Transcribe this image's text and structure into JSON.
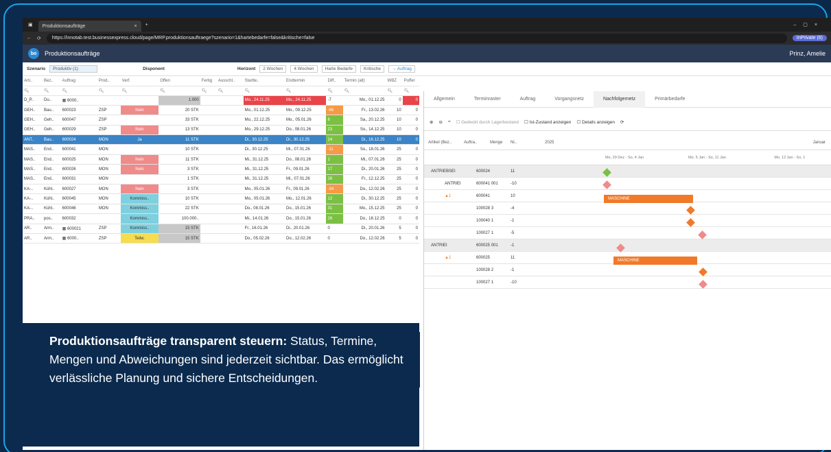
{
  "browser": {
    "tab_title": "Produktionsaufträge",
    "url": "https://innotab.test.businessexpress.cloud/page/MRP.produktionsauftraege?szenario=1&hartebedarfe=false&kritische=false",
    "profile": "InPrivate (6)"
  },
  "app": {
    "title": "Produktionsaufträge",
    "user": "Prinz, Amelie"
  },
  "filters": {
    "szenario_label": "Szenario",
    "szenario_value": "Produktiv (1)",
    "disponent_label": "Disponent",
    "horizont_label": "Horizont",
    "h1": "2 Wochen",
    "h2": "4 Wochen",
    "harte": "Harte Bedarfe",
    "kritische": "Kritische",
    "auftrag": "→ Auftrag"
  },
  "table": {
    "headers": [
      "Arti..",
      "Bez..",
      "Auftrag",
      "Prod..",
      "Verf.",
      "Offen",
      "Fertig",
      "Ausschl..",
      "Startte..",
      "Endtermin",
      "Diff..",
      "Termin (alt)",
      "WBZ",
      "Puffer"
    ],
    "rows": [
      [
        "D_P..",
        "Du..",
        "▦ 6000..",
        "",
        "",
        "1.000",
        "",
        "",
        "Mo., 24.11.25",
        "Mo., 24.11.25",
        "-7",
        "Mo., 01.12.25",
        "0",
        "0"
      ],
      [
        "GEH..",
        "Bau..",
        "600023",
        "ZSP",
        "Nein",
        "20 STK",
        "",
        "",
        "Mo., 01.12.25",
        "Mo., 09.12.25",
        "-66",
        "Fr., 13.02.26",
        "10",
        "0"
      ],
      [
        "GEH..",
        "Geh..",
        "600047",
        "ZSP",
        "",
        "33 STK",
        "",
        "",
        "Mo., 22.12.25",
        "Mo., 05.01.26",
        "6",
        "Sa., 20.12.25",
        "10",
        "0"
      ],
      [
        "GEH..",
        "Geh..",
        "600029",
        "ZSP",
        "Nein",
        "13 STK",
        "",
        "",
        "Mo., 29.12.25",
        "Do., 08.01.26",
        "23",
        "So., 14.12.25",
        "10",
        "0"
      ],
      [
        "ANT..",
        "Bau..",
        "600024",
        "MON",
        "Ja",
        "11 STK",
        "",
        "",
        "Di., 30.12.25",
        "Di., 30.12.25",
        "14",
        "Di., 16.12.25",
        "10",
        "0"
      ],
      [
        "MAS..",
        "End..",
        "600041",
        "MON",
        "",
        "10 STK",
        "",
        "",
        "Di., 30.12.25",
        "Mi., 07.01.26",
        "-11",
        "So., 18.01.26",
        "25",
        "0"
      ],
      [
        "MAS..",
        "End..",
        "600025",
        "MON",
        "Nein",
        "11 STK",
        "",
        "",
        "Mi., 31.12.25",
        "Do., 08.01.26",
        "1",
        "Mi., 07.01.26",
        "25",
        "0"
      ],
      [
        "MAS..",
        "End..",
        "600026",
        "MON",
        "Nein",
        "3 STK",
        "",
        "",
        "Mi., 31.12.25",
        "Fr., 09.01.26",
        "17",
        "Di., 20.01.26",
        "25",
        "0"
      ],
      [
        "MAS..",
        "End..",
        "600031",
        "MON",
        "",
        "1 STK",
        "",
        "",
        "Mi., 31.12.25",
        "Mi., 07.01.26",
        "26",
        "Fr., 12.12.25",
        "25",
        "0"
      ],
      [
        "KA-..",
        "Kühl..",
        "600027",
        "MON",
        "Nein",
        "3 STK",
        "",
        "",
        "Mo., 05.01.26",
        "Fr., 09.01.26",
        "-34",
        "Do., 12.02.26",
        "25",
        "0"
      ],
      [
        "KA-..",
        "Kühl..",
        "600045",
        "MON",
        "Kommiss..",
        "10 STK",
        "",
        "",
        "Mo., 05.01.26",
        "Mo., 12.01.26",
        "12",
        "Di., 30.12.25",
        "25",
        "0"
      ],
      [
        "KA-..",
        "Kühl..",
        "600046",
        "MON",
        "Kommiss..",
        "22 STK",
        "",
        "",
        "Do., 08.01.26",
        "Do., 15.01.26",
        "31",
        "Mo., 15.12.25",
        "25",
        "0"
      ],
      [
        "PRA..",
        "pos..",
        "600032",
        "",
        "Kommiss..",
        "100.000..",
        "",
        "",
        "Mi., 14.01.26",
        "Do., 15.01.26",
        "26",
        "Do., 18.12.25",
        "0",
        "0"
      ],
      [
        "AR..",
        "Arm..",
        "▦ 600021",
        "ZSP",
        "Kommiss..",
        "15 STK",
        "",
        "",
        "Fr., 16.01.26",
        "Di., 20.01.26",
        "0",
        "Di., 20.01.26",
        "5",
        "0"
      ],
      [
        "AR..",
        "Arm..",
        "▦ 6000..",
        "ZSP",
        "Teilw.",
        "15 STK",
        "",
        "",
        "Do., 05.02.26",
        "Do., 12.02.26",
        "0",
        "Do., 12.02.26",
        "5",
        "0"
      ]
    ]
  },
  "right_tabs": [
    "Allgemein",
    "Terminraster",
    "Auftrag",
    "Vorgangsnetz",
    "Nachfolgernetz",
    "Primärbedarfe"
  ],
  "toolbar": {
    "gedeckt": "Gedeckt durch Lagerbestand",
    "ist": "Ist-Zustand anzeigen",
    "details": "Details anzeigen"
  },
  "gantt": {
    "cols": [
      "Artikel (Bez..",
      "Auftra..",
      "Menge",
      "Ni.."
    ],
    "year": "2025",
    "januar": "Januar",
    "weeks": [
      "Mo, 29 Dez - So, 4 Jan",
      "Mo, 5 Jan - So, 11 Jan",
      "Mo, 12 Jan - So, 1"
    ],
    "rows": [
      [
        "ANTRIEBSEI",
        "600024",
        "11"
      ],
      [
        "ANTRIEI",
        "600041 001",
        "-10"
      ],
      [
        "▲1",
        "600041",
        "10"
      ],
      [
        "",
        "100028 3",
        "-4"
      ],
      [
        "",
        "100040 1",
        "-1"
      ],
      [
        "",
        "100027 1",
        "-5"
      ],
      [
        "ANTRIEI",
        "600025 001",
        "-1"
      ],
      [
        "▲1",
        "600025",
        "11"
      ],
      [
        "",
        "100028 2",
        "-1"
      ],
      [
        "",
        "100027 1",
        "-10"
      ]
    ],
    "bar_label": "MASCHINE"
  },
  "caption": {
    "bold": "Produktionsaufträge transparent steuern:",
    "text": " Status, Termine, Mengen und Abweichungen sind jederzeit sichtbar. Das ermöglicht verlässliche Planung und sichere Entscheidungen."
  }
}
